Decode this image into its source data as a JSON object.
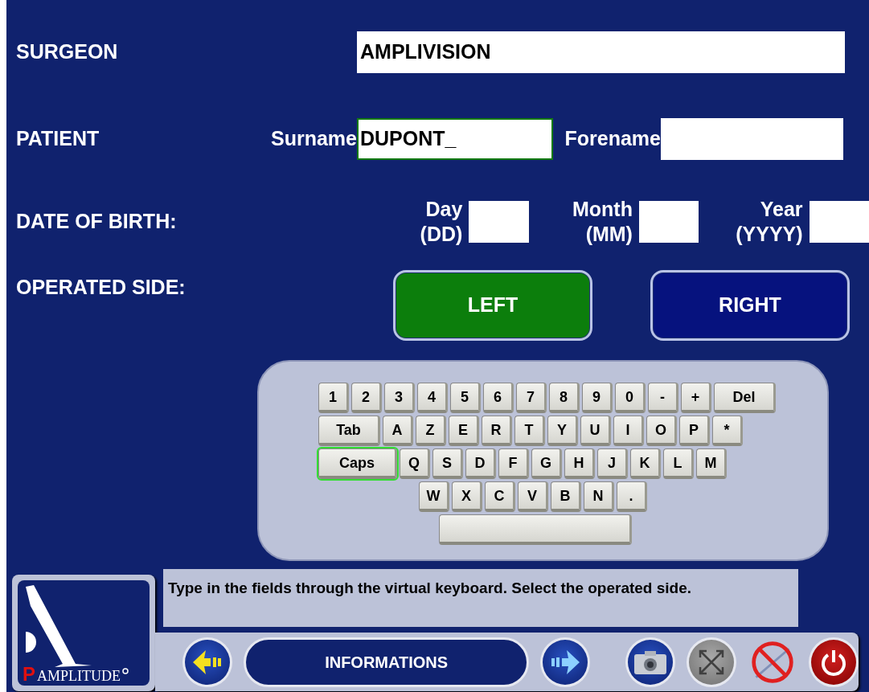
{
  "surgeon": {
    "label": "SURGEON",
    "value": "AMPLIVISION"
  },
  "patient": {
    "label": "PATIENT",
    "fields": [
      {
        "label": "Surname",
        "value": "DUPONT_",
        "selected": true
      },
      {
        "label": "Forename",
        "selected": false
      }
    ]
  },
  "date_of_birth": {
    "label": "DATE OF BIRTH:",
    "fields": [
      {
        "label": "Day",
        "format": "(DD)"
      },
      {
        "label": "Month",
        "format": "(MM)"
      },
      {
        "label": "Year",
        "format": "(YYYY)"
      }
    ]
  },
  "operated_side": {
    "label": "OPERATED SIDE:",
    "options": [
      {
        "label": "LEFT",
        "selected": true
      },
      {
        "label": "RIGHT",
        "selected": false
      }
    ]
  },
  "keyboard": {
    "rows": [
      {
        "keys": [
          {
            "kind": "key",
            "label": "1"
          },
          {
            "kind": "key",
            "label": "2"
          },
          {
            "kind": "key",
            "label": "3"
          },
          {
            "kind": "key",
            "label": "4"
          },
          {
            "kind": "key",
            "label": "5"
          },
          {
            "kind": "key",
            "label": "6"
          },
          {
            "kind": "key",
            "label": "7"
          },
          {
            "kind": "key",
            "label": "8"
          },
          {
            "kind": "key",
            "label": "9"
          },
          {
            "kind": "key",
            "label": "0"
          },
          {
            "kind": "key",
            "label": "-"
          },
          {
            "kind": "key",
            "label": "+"
          },
          {
            "kind": "wide",
            "label": "Del"
          }
        ]
      },
      {
        "keys": [
          {
            "kind": "wide",
            "label": "Tab"
          },
          {
            "kind": "key",
            "label": "A"
          },
          {
            "kind": "key",
            "label": "Z"
          },
          {
            "kind": "key",
            "label": "E"
          },
          {
            "kind": "key",
            "label": "R"
          },
          {
            "kind": "key",
            "label": "T"
          },
          {
            "kind": "key",
            "label": "Y"
          },
          {
            "kind": "key",
            "label": "U"
          },
          {
            "kind": "key",
            "label": "I"
          },
          {
            "kind": "key",
            "label": "O"
          },
          {
            "kind": "key",
            "label": "P"
          },
          {
            "kind": "key",
            "label": "*"
          }
        ]
      },
      {
        "keys": [
          {
            "kind": "caps",
            "label": "Caps",
            "selected": true
          },
          {
            "kind": "key",
            "label": "Q"
          },
          {
            "kind": "key",
            "label": "S"
          },
          {
            "kind": "key",
            "label": "D"
          },
          {
            "kind": "key",
            "label": "F"
          },
          {
            "kind": "key",
            "label": "G"
          },
          {
            "kind": "key",
            "label": "H"
          },
          {
            "kind": "key",
            "label": "J"
          },
          {
            "kind": "key",
            "label": "K"
          },
          {
            "kind": "key",
            "label": "L"
          },
          {
            "kind": "key",
            "label": "M"
          }
        ]
      },
      {
        "keys": [
          {
            "kind": "key",
            "label": "W"
          },
          {
            "kind": "key",
            "label": "X"
          },
          {
            "kind": "key",
            "label": "C"
          },
          {
            "kind": "key",
            "label": "V"
          },
          {
            "kind": "key",
            "label": "B"
          },
          {
            "kind": "key",
            "label": "N"
          },
          {
            "kind": "key",
            "label": "."
          }
        ]
      },
      {
        "keys": [
          {
            "kind": "space"
          }
        ]
      }
    ]
  },
  "message": "Type in the fields through the virtual keyboard. Select the operated side.",
  "logo": {
    "mark": "P",
    "name": "AMPLITUDE"
  },
  "toolbar": {
    "title": "INFORMATIONS",
    "buttons": [
      {
        "kind": "back",
        "disabled": false
      },
      {
        "kind": "title"
      },
      {
        "kind": "forward",
        "disabled": false
      },
      {
        "kind": "camera",
        "disabled": false
      },
      {
        "kind": "expand",
        "disabled": true
      },
      {
        "kind": "no-cable",
        "disabled": false
      },
      {
        "kind": "power",
        "disabled": false
      }
    ]
  }
}
